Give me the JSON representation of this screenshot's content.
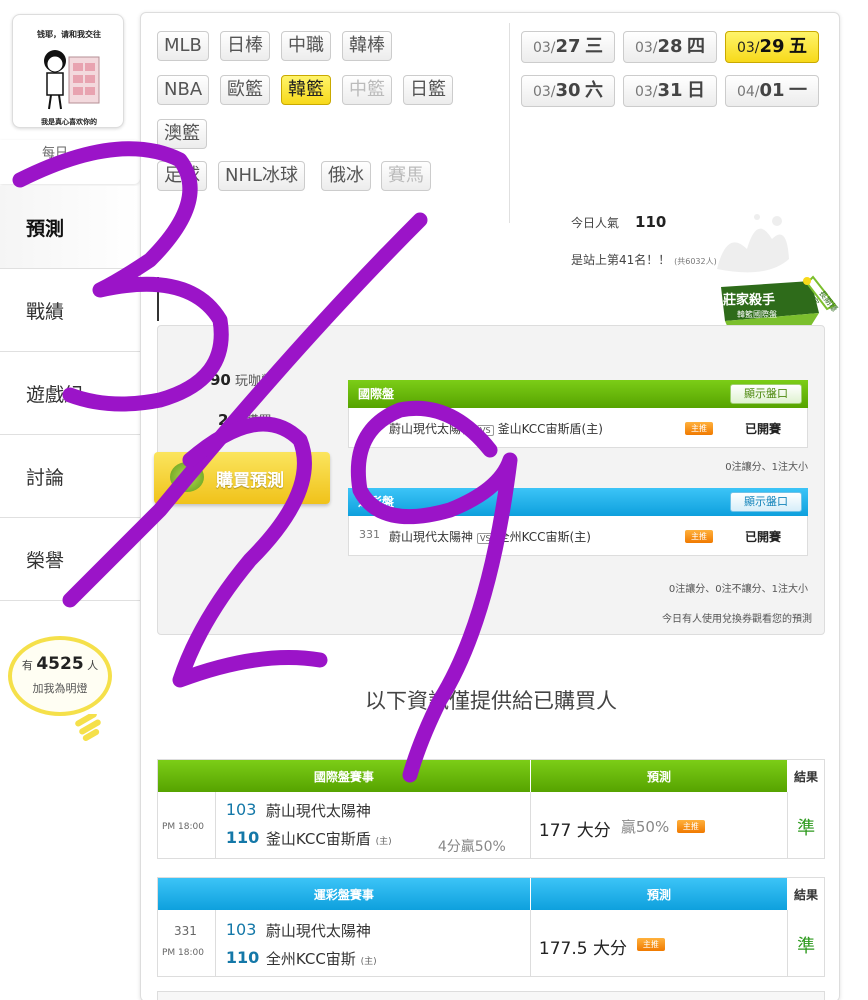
{
  "logo": {
    "top_text": "钱耶，请和我交往",
    "bottom_text": "我是真心喜欢你的"
  },
  "sidebar": {
    "tag_text": "每日",
    "items": [
      {
        "label": "預測",
        "active": true
      },
      {
        "label": "戰績",
        "active": false
      },
      {
        "label": "遊戲紀",
        "active": false
      },
      {
        "label": "討論",
        "active": false
      },
      {
        "label": "榮譽",
        "active": false
      }
    ],
    "bulb": {
      "prefix": "有",
      "count": "4525",
      "suffix": "人",
      "text": "加我為明燈"
    }
  },
  "sports": [
    {
      "label": "MLB",
      "state": "normal"
    },
    {
      "label": "日棒",
      "state": "normal"
    },
    {
      "label": "中職",
      "state": "normal"
    },
    {
      "label": "韓棒",
      "state": "normal"
    },
    {
      "label": "NBA",
      "state": "normal"
    },
    {
      "label": "歐籃",
      "state": "normal"
    },
    {
      "label": "韓籃",
      "state": "active"
    },
    {
      "label": "中籃",
      "state": "disabled"
    },
    {
      "label": "日籃",
      "state": "normal"
    },
    {
      "label": "澳籃",
      "state": "normal"
    },
    {
      "label": "足球",
      "state": "normal"
    },
    {
      "label": "NHL冰球",
      "state": "normal"
    },
    {
      "label": "俄冰",
      "state": "normal"
    },
    {
      "label": "賽馬",
      "state": "disabled"
    }
  ],
  "dates": [
    {
      "md": "03/",
      "day": "27",
      "wd": "三",
      "active": false
    },
    {
      "md": "03/",
      "day": "28",
      "wd": "四",
      "active": false
    },
    {
      "md": "03/",
      "day": "29",
      "wd": "五",
      "active": true
    },
    {
      "md": "03/",
      "day": "30",
      "wd": "六",
      "active": false
    },
    {
      "md": "03/",
      "day": "31",
      "wd": "日",
      "active": false
    },
    {
      "md": "04/",
      "day": "01",
      "wd": "一",
      "active": false
    }
  ],
  "popularity": {
    "label": "今日人氣",
    "value": "110",
    "rank_text": "是站上第41名！！",
    "rank_total": "(共6032人)"
  },
  "badge": {
    "title": "莊家殺手",
    "subtitle": "韓籃國際盤",
    "ribbon": "長期穩定"
  },
  "purchase": {
    "coins_value": "90",
    "coins_unit": "玩咖幣",
    "buyers_value": "2",
    "buyers_unit": "人購買",
    "buy_button": "購買預測"
  },
  "market_intl": {
    "header": "國際盤",
    "show_button": "顯示盤口",
    "home": "蔚山現代太陽神",
    "vs": "VS",
    "away": "釜山KCC宙斯盾(主)",
    "zhu": "主推",
    "status": "已開賽",
    "note": "0注讓分、1注大小"
  },
  "market_sport": {
    "header": "運彩盤",
    "show_button": "顯示盤口",
    "num": "331",
    "home": "蔚山現代太陽神",
    "away": "全州KCC宙斯(主)",
    "zhu": "主推",
    "status": "已開賽",
    "note": "0注讓分、0注不讓分、1注大小",
    "coupon_note": "今日有人使用兌換券觀看您的預測"
  },
  "info_title": "以下資訊僅提供給已購買人",
  "table_intl": {
    "headers": [
      "國際盤賽事",
      "預測",
      "結果"
    ],
    "time": "PM 18:00",
    "team1_num": "103",
    "team1_name": "蔚山現代太陽神",
    "team2_num": "110",
    "team2_name": "釜山KCC宙斯盾",
    "team2_tag": "(主)",
    "handicap": "4分贏50%",
    "prediction": "177 大分",
    "win": "贏50%",
    "zhu": "主推",
    "result": "準"
  },
  "table_sport": {
    "headers": [
      "運彩盤賽事",
      "預測",
      "結果"
    ],
    "num": "331",
    "time": "PM 18:00",
    "team1_num": "103",
    "team1_name": "蔚山現代太陽神",
    "team2_num": "110",
    "team2_name": "全州KCC宙斯",
    "team2_tag": "(主)",
    "prediction": "177.5 大分",
    "zhu": "主推",
    "result": "準"
  },
  "colors": {
    "accent_yellow": "#f7d91a",
    "green_header": "#56a300",
    "blue_header": "#0ea0dd",
    "scribble": "#9b14c8"
  }
}
